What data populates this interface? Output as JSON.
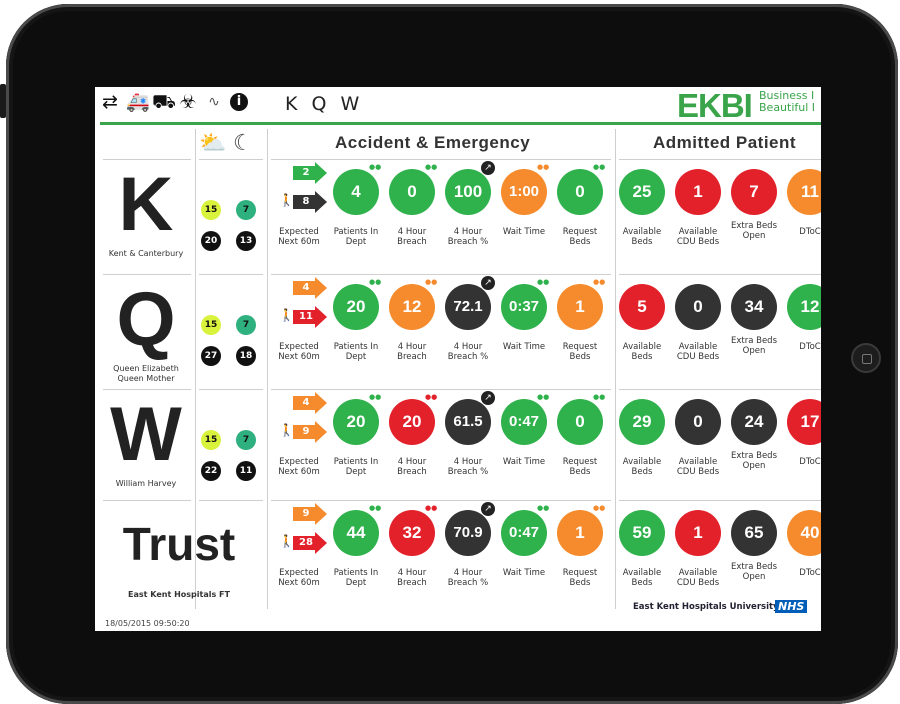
{
  "toolbar": {
    "icons": [
      "transfer-arrows-icon",
      "ambulance-icon",
      "stretcher-icon",
      "biohazard-icon",
      "trend-icon",
      "info-icon"
    ],
    "site_codes": "K Q W"
  },
  "brand": {
    "logo": "EKBI",
    "tag_line1": "Business I",
    "tag_line2": "Beautiful I"
  },
  "sections": {
    "ae_title": "Accident & Emergency",
    "admitted_title": "Admitted Patient"
  },
  "weather_head": {
    "day_icon": "☀",
    "night_icon": "☾"
  },
  "labels": {
    "expected": "Expected Next 60m",
    "patients": "Patients In Dept",
    "breach": "4 Hour Breach",
    "breach_pct": "4 Hour Breach %",
    "wait": "Wait Time",
    "request": "Request Beds",
    "available": "Available Beds",
    "cdu": "Available CDU Beds",
    "extra": "Extra Beds Open",
    "dtoc": "DToC"
  },
  "colors": {
    "green": "#2fb24c",
    "orange": "#f58b2c",
    "red": "#e3212b",
    "dark": "#333333",
    "lime": "#d9f23c",
    "teal": "#2fb07f"
  },
  "rows": [
    {
      "letter": "K",
      "name": "Kent & Canterbury",
      "temp_day": "15",
      "temp_night": "7",
      "badge1": "20",
      "badge2": "13",
      "amb_expected": "2",
      "amb_color": "green",
      "walk_expected": "8",
      "walk_color": "dark",
      "patients": "4",
      "patients_color": "green",
      "breach": "0",
      "breach_color": "green",
      "breach_pct": "100",
      "breach_pct_color": "green",
      "wait": "1:00",
      "wait_color": "orange",
      "request": "0",
      "request_color": "green",
      "available": "25",
      "available_color": "green",
      "cdu": "1",
      "cdu_color": "red",
      "extra": "7",
      "extra_color": "red",
      "dtoc": "11",
      "dtoc_color": "orange"
    },
    {
      "letter": "Q",
      "name": "Queen Elizabeth Queen Mother",
      "temp_day": "15",
      "temp_night": "7",
      "badge1": "27",
      "badge2": "18",
      "amb_expected": "4",
      "amb_color": "orange",
      "walk_expected": "11",
      "walk_color": "red",
      "patients": "20",
      "patients_color": "green",
      "breach": "12",
      "breach_color": "orange",
      "breach_pct": "72.1",
      "breach_pct_color": "dark",
      "wait": "0:37",
      "wait_color": "green",
      "request": "1",
      "request_color": "orange",
      "available": "5",
      "available_color": "red",
      "cdu": "0",
      "cdu_color": "dark",
      "extra": "34",
      "extra_color": "dark",
      "dtoc": "12",
      "dtoc_color": "green"
    },
    {
      "letter": "W",
      "name": "William Harvey",
      "temp_day": "15",
      "temp_night": "7",
      "badge1": "22",
      "badge2": "11",
      "amb_expected": "4",
      "amb_color": "orange",
      "walk_expected": "9",
      "walk_color": "orange",
      "patients": "20",
      "patients_color": "green",
      "breach": "20",
      "breach_color": "red",
      "breach_pct": "61.5",
      "breach_pct_color": "dark",
      "wait": "0:47",
      "wait_color": "green",
      "request": "0",
      "request_color": "green",
      "available": "29",
      "available_color": "green",
      "cdu": "0",
      "cdu_color": "dark",
      "extra": "24",
      "extra_color": "dark",
      "dtoc": "17",
      "dtoc_color": "red"
    },
    {
      "letter": "Trust",
      "name": "East Kent Hospitals FT",
      "amb_expected": "9",
      "amb_color": "orange",
      "walk_expected": "28",
      "walk_color": "red",
      "patients": "44",
      "patients_color": "green",
      "breach": "32",
      "breach_color": "red",
      "breach_pct": "70.9",
      "breach_pct_color": "dark",
      "wait": "0:47",
      "wait_color": "green",
      "request": "1",
      "request_color": "orange",
      "available": "59",
      "available_color": "green",
      "cdu": "1",
      "cdu_color": "red",
      "extra": "65",
      "extra_color": "dark",
      "dtoc": "40",
      "dtoc_color": "orange"
    }
  ],
  "footer": {
    "timestamp": "18/05/2015 09:50:20",
    "org": "East Kent Hospitals University",
    "nhs": "NHS",
    "nhs_sub": "NHS Foundation Trust"
  }
}
